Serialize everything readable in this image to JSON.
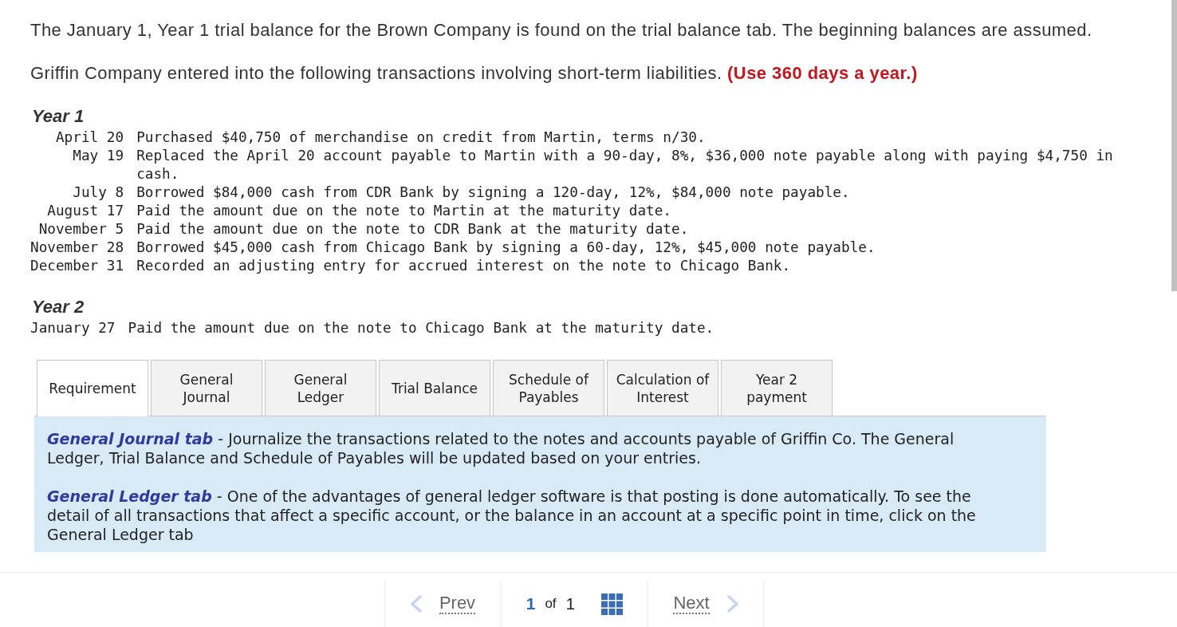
{
  "intro": [
    "The January 1, Year 1 trial balance for the Brown Company is found on the trial balance tab. The beginning balances are assumed.",
    "Griffin Company entered into the following transactions involving short-term liabilities. **(Use 360 days a year.)**"
  ],
  "years": [
    {
      "heading": "Year 1",
      "transactions": [
        {
          "date": "April 20",
          "description": "Purchased $40,750 of merchandise on credit from Martin, terms n/30."
        },
        {
          "date": "May 19",
          "description": "Replaced the April 20 account payable to Martin with a 90-day, 8%, $36,000 note payable along with paying $4,750 in cash."
        },
        {
          "date": "July 8",
          "description": "Borrowed $84,000 cash from CDR Bank by signing a 120-day, 12%, $84,000 note payable."
        },
        {
          "date": "August 17",
          "description": "Paid the amount due on the note to Martin at the maturity date."
        },
        {
          "date": "November 5",
          "description": "Paid the amount due on the note to CDR Bank at the maturity date."
        },
        {
          "date": "November 28",
          "description": "Borrowed $45,000 cash from Chicago Bank by signing a 60-day, 12%, $45,000 note payable."
        },
        {
          "date": "December 31",
          "description": "Recorded an adjusting entry for accrued interest on the note to Chicago Bank."
        }
      ]
    },
    {
      "heading": "Year 2",
      "transactions": [
        {
          "date": "January 27",
          "description": "Paid the amount due on the note to Chicago Bank at the maturity date."
        }
      ]
    }
  ],
  "tabs": [
    {
      "label": "Requirement",
      "selected": true
    },
    {
      "label": "General Journal",
      "selected": false
    },
    {
      "label": "General Ledger",
      "selected": false
    },
    {
      "label": "Trial Balance",
      "selected": false
    },
    {
      "label": "Schedule of Payables",
      "selected": false
    },
    {
      "label": "Calculation of Interest",
      "selected": false
    },
    {
      "label": "Year 2 payment",
      "selected": false
    }
  ],
  "panel": {
    "paragraphs": [
      "**General Journal tab** - Journalize the transactions related to the notes and accounts payable of Griffin Co. The General Ledger, Trial Balance and Schedule of Payables will be updated based on your entries.",
      "**General Ledger tab** - One of the advantages of general ledger software is that posting is done automatically. To see the detail of all transactions that affect a specific account, or the balance in an account at a specific point in time, click on the General Ledger tab"
    ]
  },
  "pager": {
    "prev": "Prev",
    "current": "1",
    "of": "of",
    "total": "1",
    "next": "Next"
  }
}
